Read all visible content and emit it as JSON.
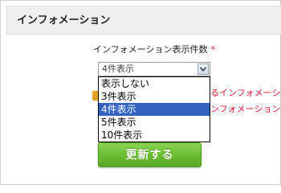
{
  "section": {
    "title": "インフォメーション"
  },
  "field": {
    "label": "インフォメーション表示件数",
    "required_mark": "*"
  },
  "select": {
    "current_value": "4件表示",
    "options": [
      "表示しない",
      "3件表示",
      "4件表示",
      "5件表示",
      "10件表示"
    ],
    "highlighted_option": "4件表示"
  },
  "obscured_messages": [
    "るインフォメーシ",
    "ンフォメーション"
  ],
  "button": {
    "label": "更新する"
  },
  "colors": {
    "required": "#e0203a",
    "selected_option_bg": "#3162c0",
    "button_green": "#6ec136",
    "header_bg": "#efefef"
  },
  "icons": {
    "select_arrow": "chevron-down-icon",
    "warning": "warning-icon"
  }
}
